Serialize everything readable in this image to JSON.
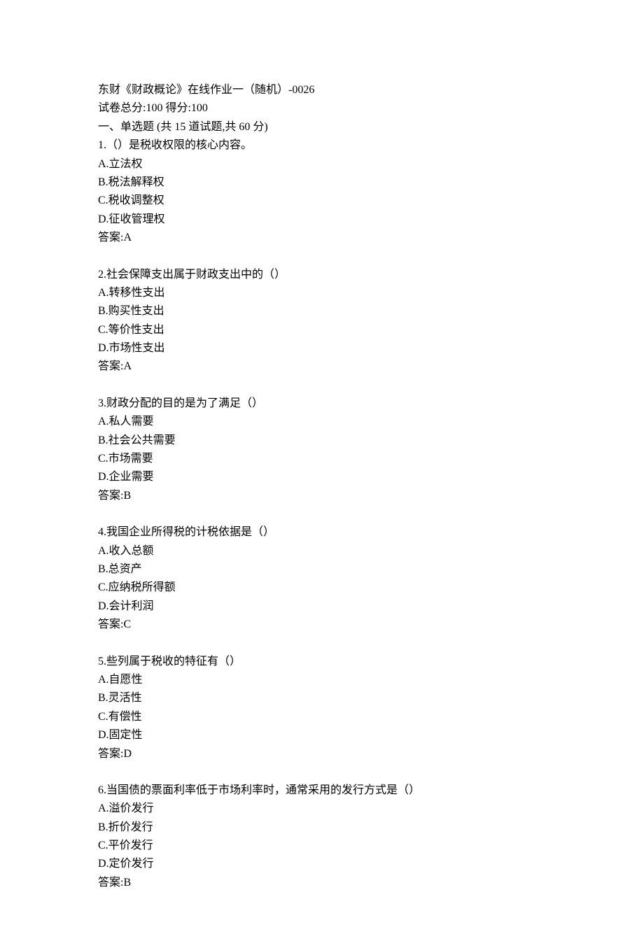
{
  "header": {
    "title": "东财《财政概论》在线作业一（随机）-0026",
    "score_line": "试卷总分:100   得分:100",
    "section": "一、单选题 (共 15 道试题,共 60 分)"
  },
  "questions": [
    {
      "stem": "1.（）是税收权限的核心内容。",
      "options": [
        "A.立法权",
        "B.税法解释权",
        "C.税收调整权",
        "D.征收管理权"
      ],
      "answer": "答案:A"
    },
    {
      "stem": "2.社会保障支出属于财政支出中的（）",
      "options": [
        "A.转移性支出",
        "B.购买性支出",
        "C.等价性支出",
        "D.市场性支出"
      ],
      "answer": "答案:A"
    },
    {
      "stem": "3.财政分配的目的是为了满足（）",
      "options": [
        "A.私人需要",
        "B.社会公共需要",
        "C.市场需要",
        "D.企业需要"
      ],
      "answer": "答案:B"
    },
    {
      "stem": "4.我国企业所得税的计税依据是（）",
      "options": [
        "A.收入总额",
        "B.总资产",
        "C.应纳税所得额",
        "D.会计利润"
      ],
      "answer": "答案:C"
    },
    {
      "stem": "5.些列属于税收的特征有（）",
      "options": [
        "A.自愿性",
        "B.灵活性",
        "C.有偿性",
        "D.固定性"
      ],
      "answer": "答案:D"
    },
    {
      "stem": "6.当国债的票面利率低于市场利率时，通常采用的发行方式是（）",
      "options": [
        "A.溢价发行",
        "B.折价发行",
        "C.平价发行",
        "D.定价发行"
      ],
      "answer": "答案:B"
    }
  ]
}
